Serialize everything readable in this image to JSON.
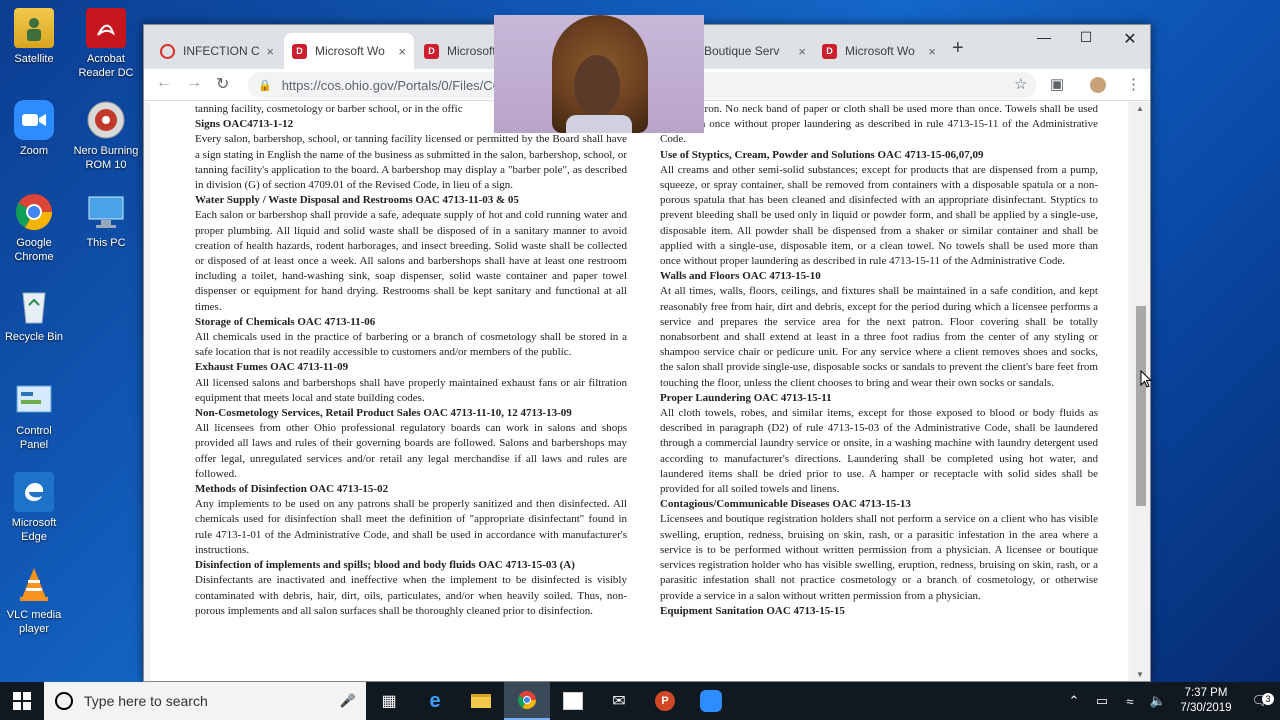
{
  "desktop": {
    "icons": [
      {
        "label": "Satellite"
      },
      {
        "label": "Acrobat Reader DC"
      },
      {
        "label": "Zoom"
      },
      {
        "label": "Nero Burning ROM 10"
      },
      {
        "label": "Google Chrome"
      },
      {
        "label": "This PC"
      },
      {
        "label": "Recycle Bin"
      },
      {
        "label": "Control Panel"
      },
      {
        "label": "Microsoft Edge"
      },
      {
        "label": "VLC media player"
      }
    ]
  },
  "browser": {
    "tabs": [
      {
        "title": "INFECTION CO",
        "close": "×"
      },
      {
        "title": "Microsoft Wo",
        "close": "×"
      },
      {
        "title": "Microsoft",
        "close": "×"
      },
      {
        "title": "Boutique Serv",
        "close": "×"
      },
      {
        "title": "Microsoft Wo",
        "close": "×"
      }
    ],
    "new_tab": "+",
    "url": "https://cos.ohio.gov/Portals/0/Files/CO"
  },
  "document": {
    "left": [
      {
        "type": "p",
        "text": "tanning facility, cosmetology or barber school, or in the offic"
      },
      {
        "type": "h",
        "text": "Signs OAC4713-1-12"
      },
      {
        "type": "p",
        "text": "Every salon, barbershop, school, or tanning facility licensed or permitted by the Board shall have a sign stating in English the name of the business as submitted in the salon, barbershop, school, or tanning facility's application to the board. A barbershop may display a \"barber pole\", as described in division (G) of section 4709.01 of the Revised Code, in lieu of a sign."
      },
      {
        "type": "h",
        "text": "Water Supply / Waste Disposal and Restrooms   OAC 4713-11-03 & 05"
      },
      {
        "type": "p",
        "text": "Each salon or barbershop shall provide a safe, adequate supply of hot and cold running water and proper plumbing. All liquid and solid waste shall be disposed of in a sanitary manner to avoid creation of health hazards, rodent harborages, and insect breeding. Solid waste shall be collected or disposed of at least once a week. All salons and barbershops shall have at least one restroom including a toilet, hand-washing sink, soap dispenser, solid waste container and paper towel dispenser or equipment for hand drying. Restrooms shall be kept sanitary and functional at all times."
      },
      {
        "type": "h",
        "text": "Storage of Chemicals   OAC 4713-11-06"
      },
      {
        "type": "p",
        "text": "All chemicals used in the practice of barbering or a branch of cosmetology shall be stored in a safe location that is not readily accessible to customers and/or members of the public."
      },
      {
        "type": "h",
        "text": "Exhaust Fumes OAC 4713-11-09"
      },
      {
        "type": "p",
        "text": "All licensed salons and barbershops shall have properly maintained exhaust fans or air filtration equipment that meets local and state building codes."
      },
      {
        "type": "h",
        "text": "Non-Cosmetology Services, Retail Product Sales    OAC 4713-11-10, 12 4713-13-09"
      },
      {
        "type": "p",
        "text": "All licensees from other Ohio professional regulatory boards can work in salons and shops provided all laws and rules of their governing boards are followed. Salons and barbershops may offer legal, unregulated services and/or retail any legal merchandise if all laws and rules are followed."
      },
      {
        "type": "h",
        "text": "Methods of Disinfection OAC 4713-15-02"
      },
      {
        "type": "p",
        "text": "Any implements to be used on any patrons shall be properly sanitized and then disinfected. All chemicals used for disinfection shall meet the definition of \"appropriate disinfectant\" found in rule 4713-1-01 of the Administrative Code, and shall be used in accordance with manufacturer's instructions."
      },
      {
        "type": "h",
        "text": "Disinfection of implements and spills; blood and body fluids   OAC 4713-15-03 (A)"
      },
      {
        "type": "p",
        "text": "Disinfectants are inactivated and ineffective when the implement to be disinfected is visibly contaminated with debris, hair, dirt, oils, particulates, and/or when heavily soiled. Thus, non-porous implements and all salon surfaces shall be thoroughly cleaned prior to disinfection."
      }
    ],
    "right": [
      {
        "type": "p",
        "text": "with a patron. No neck band of paper or cloth shall be used more than once. Towels shall be used more than once without proper laundering as described in rule 4713-15-11 of the Administrative Code."
      },
      {
        "type": "h",
        "text": "Use of Styptics, Cream, Powder and Solutions   OAC 4713-15-06,07,09"
      },
      {
        "type": "p",
        "text": "All creams and other semi-solid substances; except for products that are dispensed from a pump, squeeze, or spray container, shall be removed from containers with a disposable spatula or a non-porous spatula that has been cleaned and disinfected with an appropriate disinfectant. Styptics to prevent bleeding shall be used only in liquid or powder form, and shall be applied by a single-use, disposable item. All powder shall be dispensed from a shaker or similar container and shall be applied with a single-use, disposable item, or a clean towel. No towels shall be used more than once without proper laundering as described in rule 4713-15-11 of the Administrative Code."
      },
      {
        "type": "h",
        "text": "Walls and Floors   OAC 4713-15-10"
      },
      {
        "type": "p",
        "text": "At all times, walls, floors, ceilings, and fixtures shall be maintained in a safe condition, and kept reasonably free from hair, dirt and debris, except for the period during which a licensee performs a service and prepares the service area for the next patron. Floor covering shall be totally nonabsorbent and shall extend at least in a three foot radius from the center of any styling or shampoo service chair or pedicure unit. For any service where a client removes shoes and socks, the salon shall provide single-use, disposable socks or sandals to prevent the client's bare feet from touching the floor, unless the client chooses to bring and wear their own socks or sandals."
      },
      {
        "type": "h",
        "text": "Proper Laundering OAC 4713-15-11"
      },
      {
        "type": "p",
        "text": "All cloth towels, robes, and similar items, except for those exposed to blood or body fluids as described in paragraph (D2) of rule 4713-15-03 of the Administrative Code, shall be laundered through a commercial laundry service or onsite, in a washing machine with laundry detergent used according to manufacturer's directions. Laundering shall be completed using hot water, and laundered items shall be dried prior to use. A hamper or receptacle with solid sides shall be provided for all soiled towels and linens."
      },
      {
        "type": "h",
        "text": "Contagious/Communicable Diseases   OAC 4713-15-13"
      },
      {
        "type": "p",
        "text": "Licensees and boutique registration holders shall not perform a service on a client who has visible swelling, eruption, redness, bruising on skin, rash, or a parasitic infestation in the area where a service is to be performed without written permission from a physician. A licensee or boutique services registration holder who has visible swelling, eruption, redness, bruising on skin, rash, or a parasitic infestation shall not practice cosmetology or a branch of cosmetology, or otherwise provide a service in a salon without written permission from a physician."
      },
      {
        "type": "h",
        "text": "Equipment Sanitation   OAC 4713-15-15"
      }
    ]
  },
  "taskbar": {
    "search_placeholder": "Type here to search",
    "time": "7:37 PM",
    "date": "7/30/2019",
    "notification_count": "3"
  }
}
